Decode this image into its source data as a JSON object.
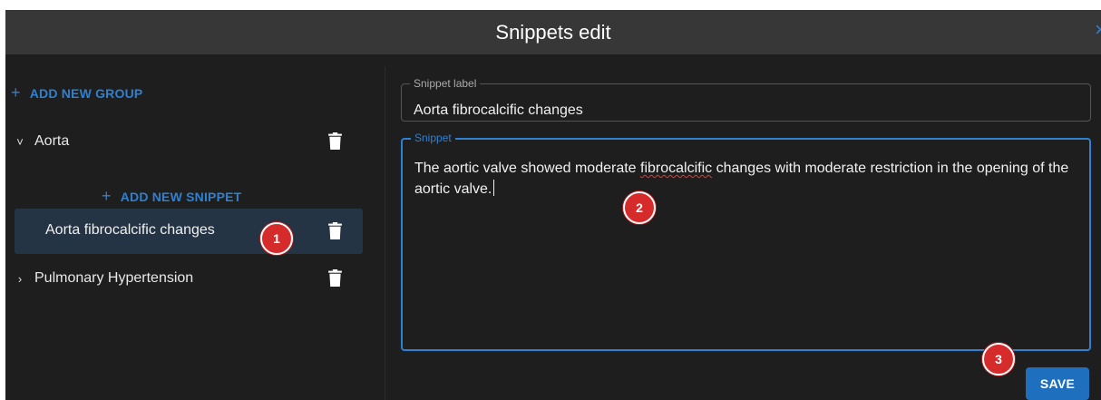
{
  "dialog": {
    "title": "Snippets edit",
    "close_glyph": "×"
  },
  "sidebar": {
    "add_group_icon": "plus-icon",
    "add_group_label": "ADD NEW GROUP",
    "groups": [
      {
        "label": "Aorta",
        "expanded": true,
        "chevron": "˅",
        "add_snippet_label": "ADD NEW SNIPPET",
        "snippets": [
          {
            "label": "Aorta fibrocalcific changes",
            "selected": true
          }
        ]
      },
      {
        "label": "Pulmonary Hypertension",
        "expanded": false,
        "chevron": "›"
      }
    ]
  },
  "editor": {
    "label_field": {
      "label": "Snippet label",
      "value": "Aorta fibrocalcific changes"
    },
    "snippet_field": {
      "label": "Snippet",
      "text_before": "The aortic valve showed moderate ",
      "misspelled_word": "fibrocalcific",
      "text_after": " changes with moderate restriction in the opening of the aortic valve."
    },
    "save_label": "SAVE"
  },
  "markers": [
    "1",
    "2",
    "3"
  ],
  "colors": {
    "accent": "#2f80d0",
    "selected_bg": "#253445",
    "marker": "#d62b2b",
    "dialog_bg": "#1e1e1e",
    "titlebar_bg": "#373737"
  }
}
